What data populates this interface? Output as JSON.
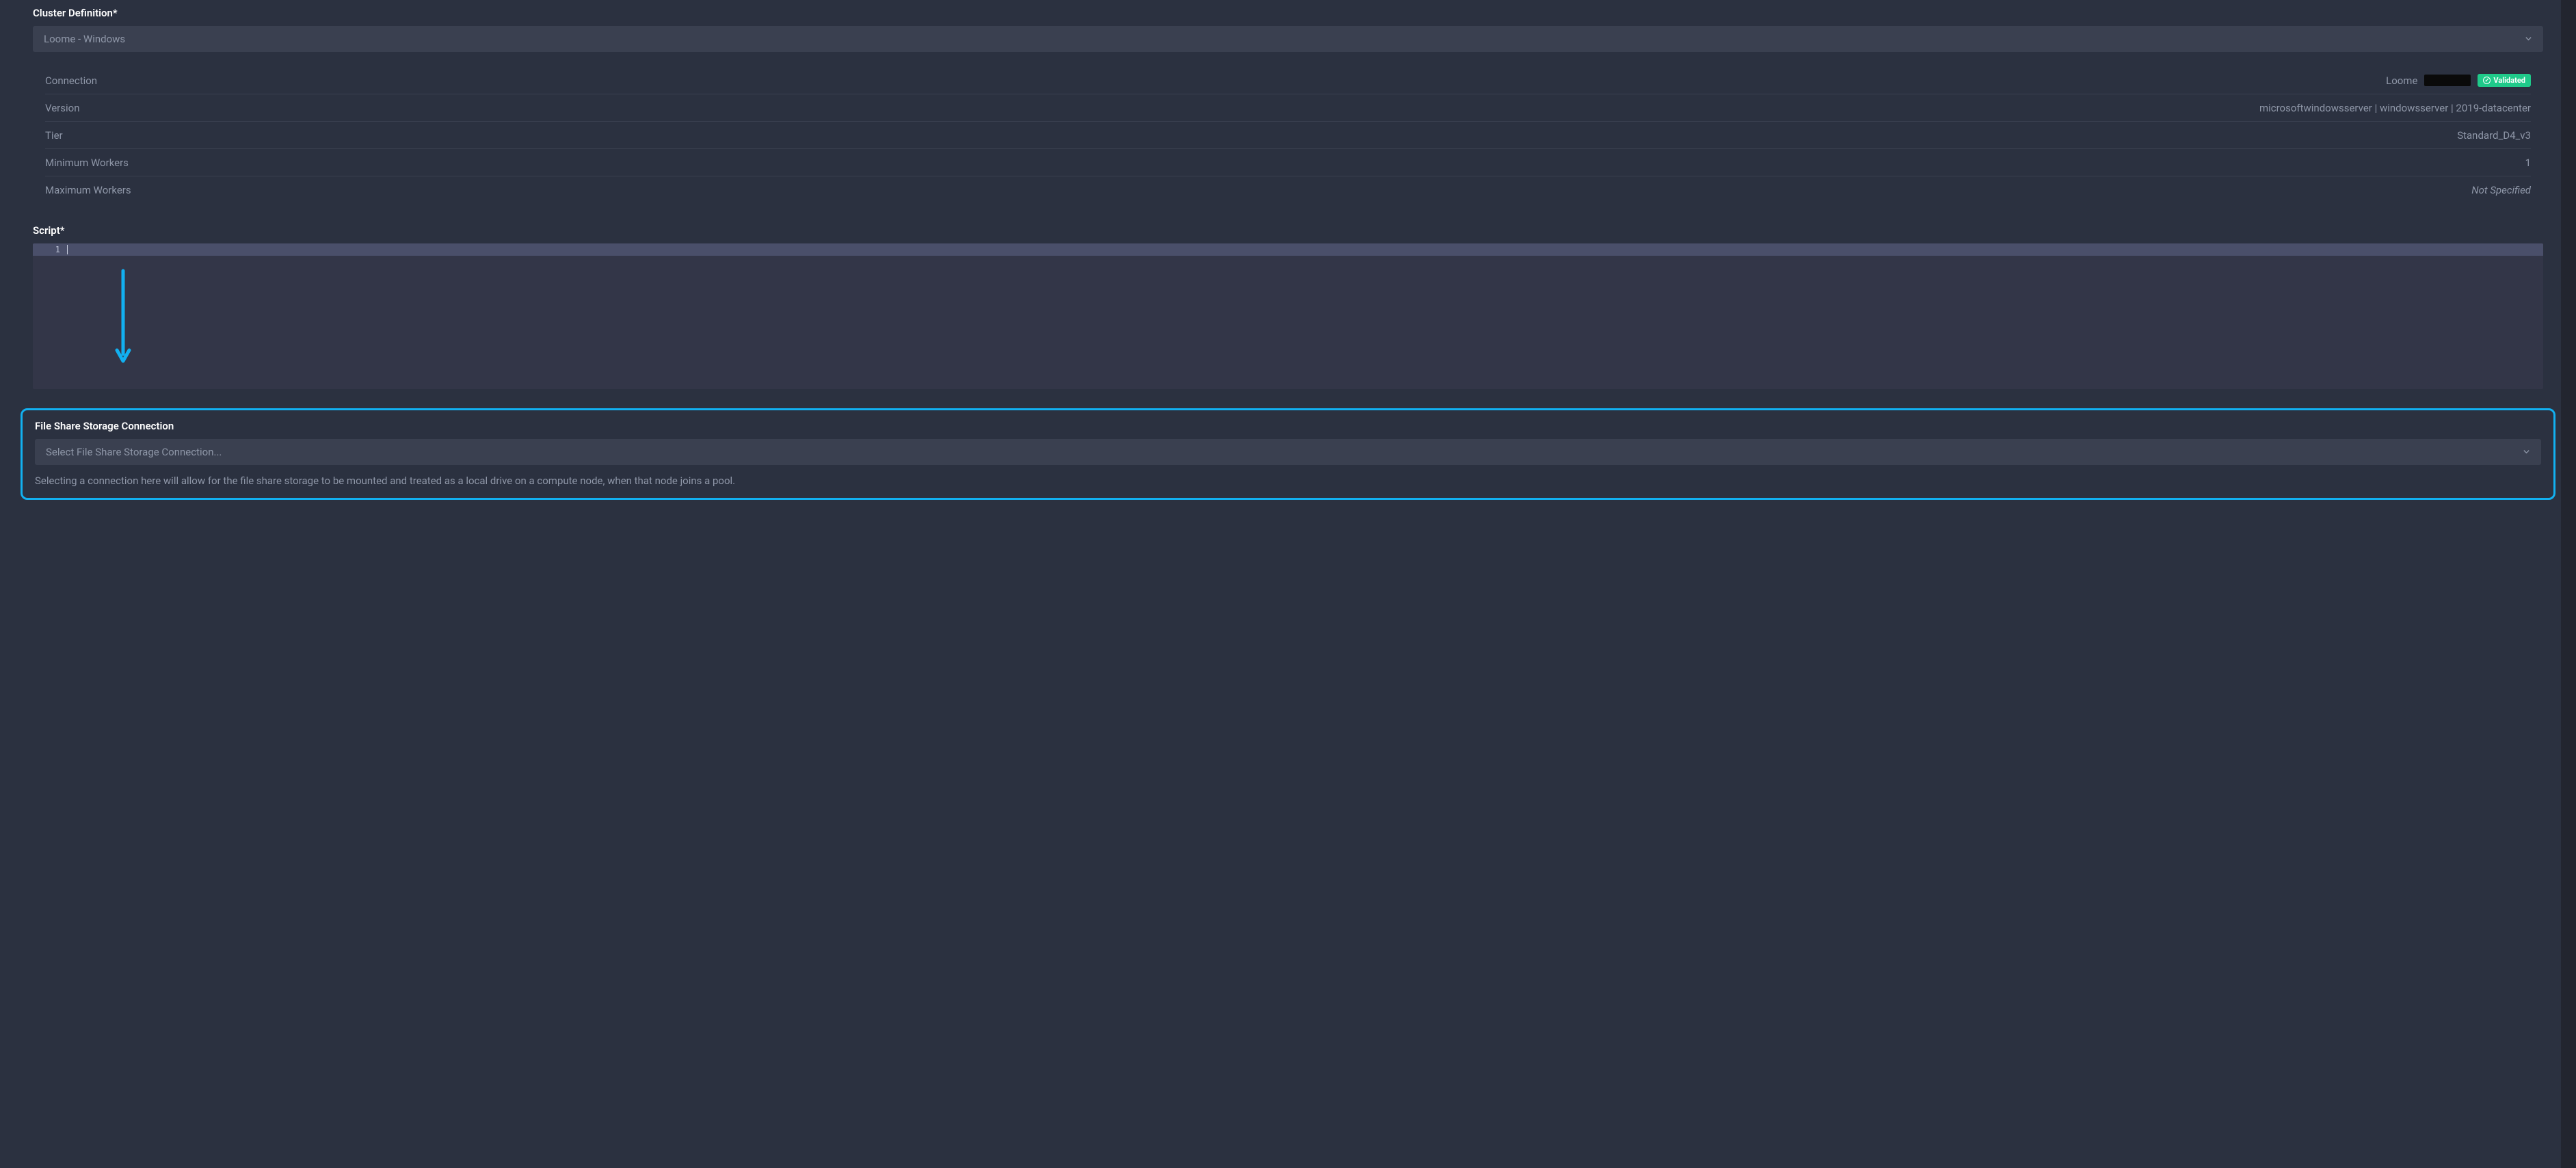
{
  "cluster": {
    "label": "Cluster Definition*",
    "selected": "Loome  - Windows",
    "details": {
      "connection_label": "Connection",
      "connection_value": "Loome",
      "validated_badge": "Validated",
      "version_label": "Version",
      "version_value": "microsoftwindowsserver | windowsserver | 2019-datacenter",
      "tier_label": "Tier",
      "tier_value": "Standard_D4_v3",
      "min_workers_label": "Minimum Workers",
      "min_workers_value": "1",
      "max_workers_label": "Maximum Workers",
      "max_workers_value": "Not Specified"
    }
  },
  "script": {
    "label": "Script*",
    "line_number": "1"
  },
  "fileshare": {
    "label": "File Share Storage Connection",
    "placeholder": "Select File Share Storage Connection...",
    "help": "Selecting a connection here will allow for the file share storage to be mounted and treated as a local drive on a compute node, when that node joins a pool."
  },
  "colors": {
    "accent": "#12b0f0",
    "success": "#1fca8a"
  }
}
